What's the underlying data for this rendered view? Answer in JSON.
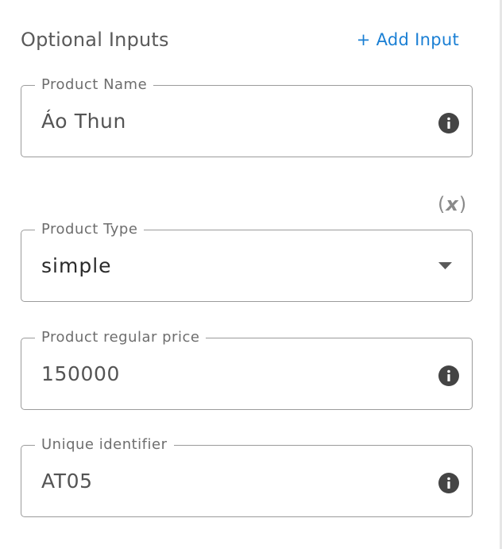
{
  "header": {
    "title": "Optional Inputs",
    "add_label": "+ Add Input"
  },
  "variable_toggle": {
    "open": "(",
    "x": "x",
    "close": ")"
  },
  "fields": [
    {
      "label": "Product Name",
      "value": "Áo Thun",
      "control": "info-icon"
    },
    {
      "label": "Product Type",
      "value": "simple",
      "control": "dropdown-caret"
    },
    {
      "label": "Product regular price",
      "value": "150000",
      "control": "info-icon"
    },
    {
      "label": "Unique identifier",
      "value": "AT05",
      "control": "info-icon"
    }
  ],
  "colors": {
    "accent": "#1a7fd4",
    "border": "#9b9b9b",
    "label": "#6e6e6e",
    "icon": "#444444"
  }
}
